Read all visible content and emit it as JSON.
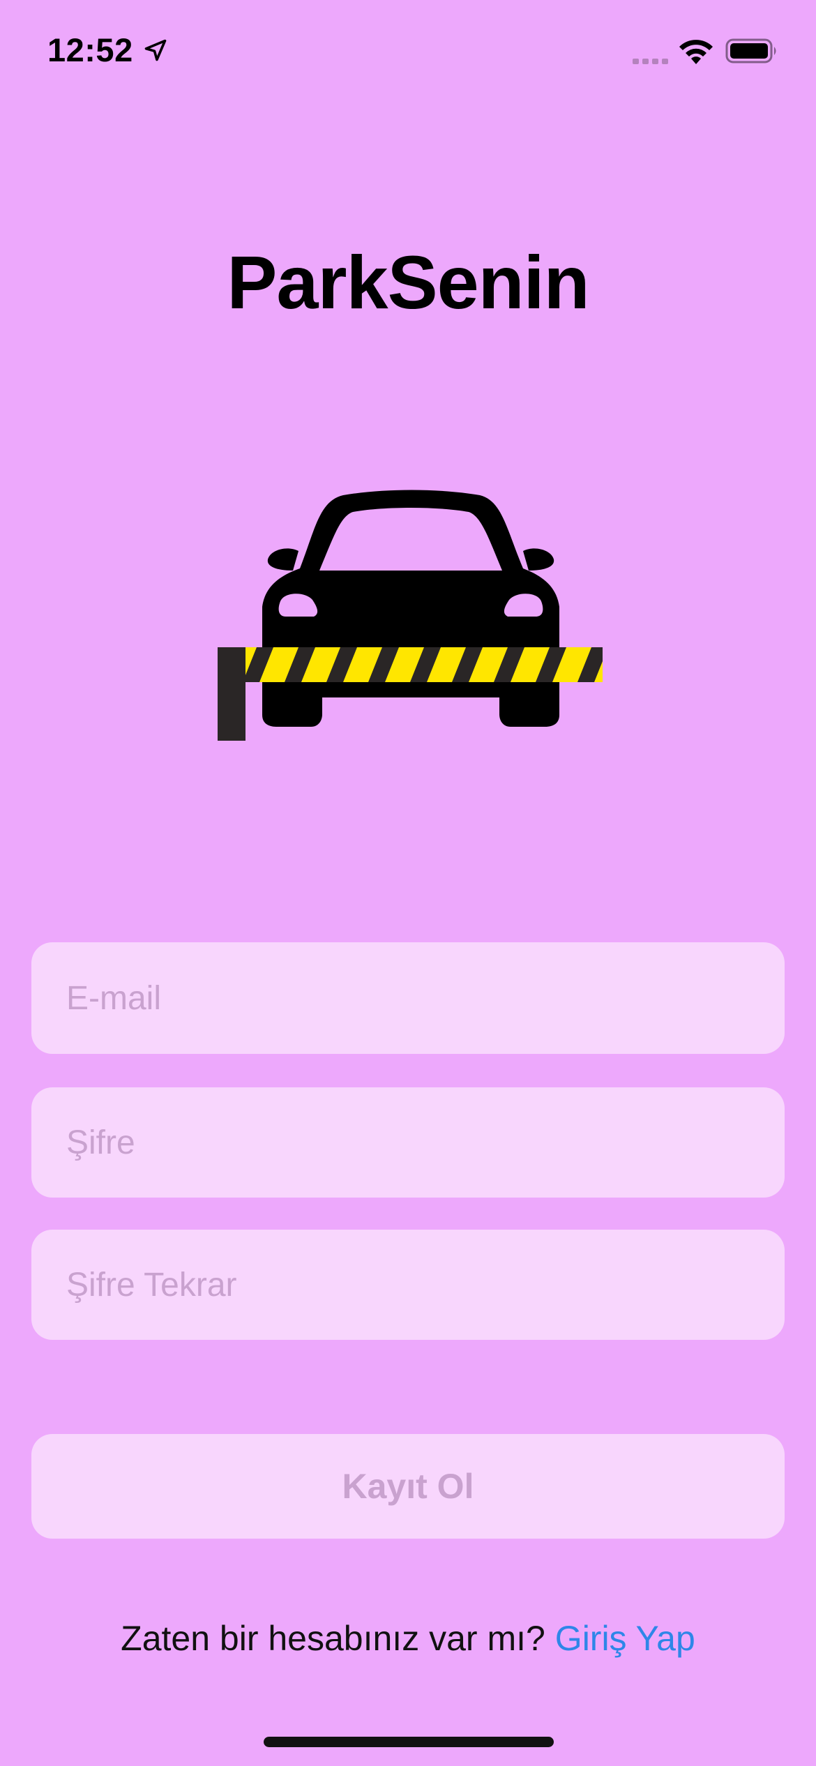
{
  "status_bar": {
    "time": "12:52",
    "icons": [
      "location-arrow-icon",
      "cellular-signal-icon",
      "wifi-icon",
      "battery-icon"
    ]
  },
  "app": {
    "title": "ParkSenin",
    "logo_icon": "car-barrier-icon"
  },
  "form": {
    "email_placeholder": "E-mail",
    "password_placeholder": "Şifre",
    "password_repeat_placeholder": "Şifre Tekrar",
    "email_value": "",
    "password_value": "",
    "password_repeat_value": ""
  },
  "register_button": {
    "label": "Kayıt Ol"
  },
  "login_prompt": {
    "text": "Zaten bir hesabınız var mı?",
    "link_label": "Giriş Yap"
  },
  "colors": {
    "background": "#EDA8FC",
    "field_background": "#F8D6FD",
    "placeholder": "#C9A2CF",
    "link": "#2E86E8",
    "barrier_yellow": "#FFE600",
    "barrier_dark": "#2A2626"
  }
}
